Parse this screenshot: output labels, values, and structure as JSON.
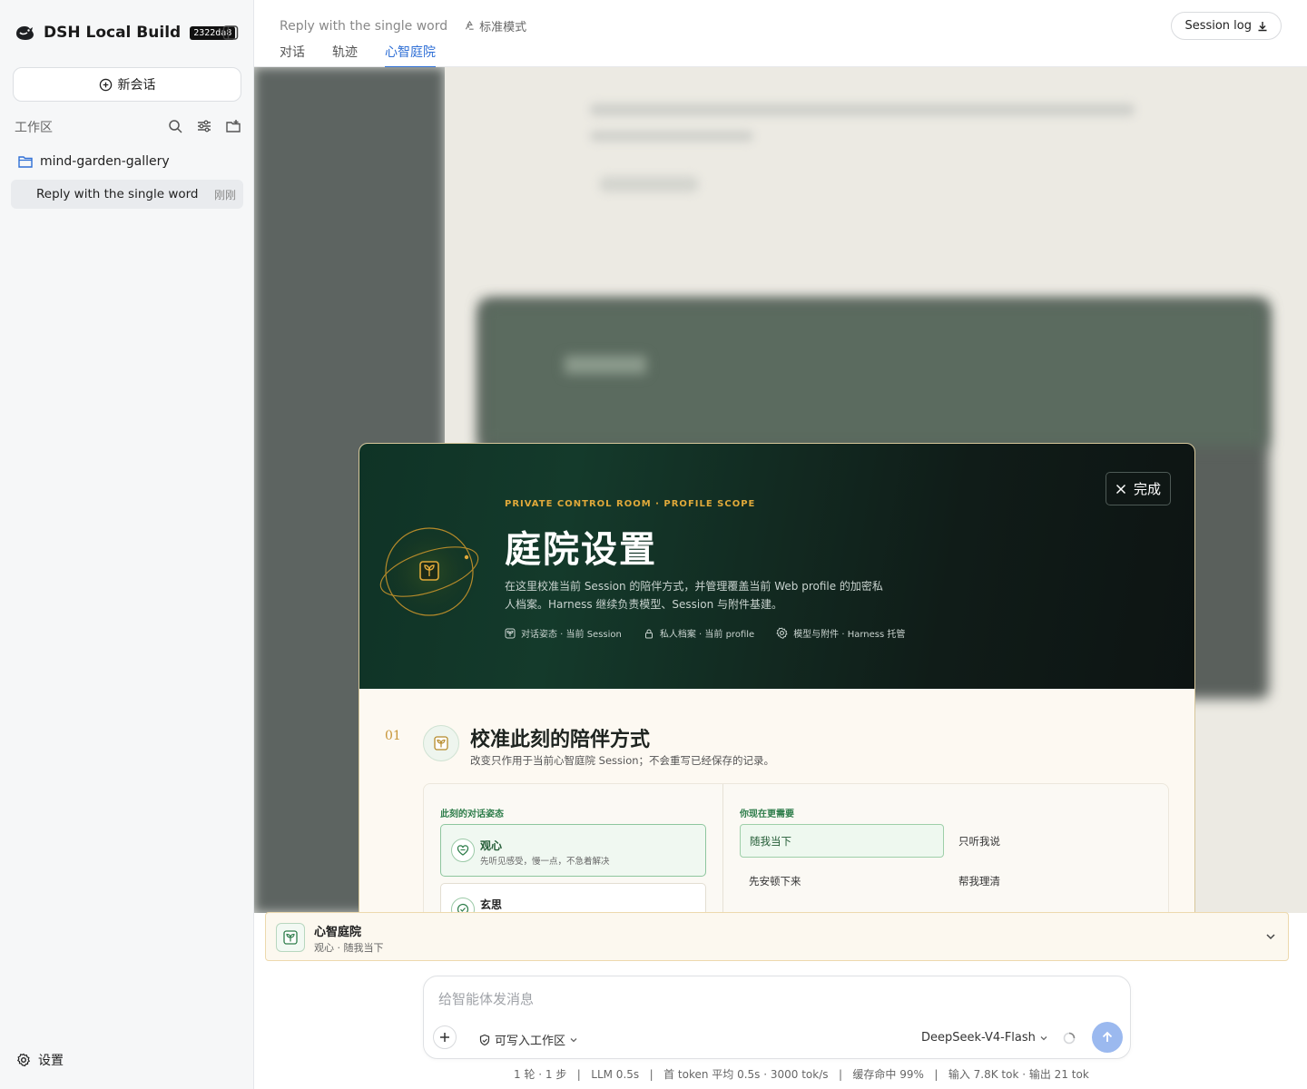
{
  "app": {
    "name": "DSH Local Build",
    "build": "2322da8"
  },
  "sidebar": {
    "new_chat": "新会话",
    "workspace_label": "工作区",
    "folder": "mind-garden-gallery",
    "session_title": "Reply with the single word",
    "session_time": "刚刚",
    "settings": "设置"
  },
  "header": {
    "breadcrumb": "Reply with the single word",
    "mode": "标准模式",
    "tabs": [
      "对话",
      "轨迹",
      "心智庭院"
    ],
    "active_tab": 2,
    "session_log": "Session log"
  },
  "modal": {
    "done": "完成",
    "eyebrow": "PRIVATE CONTROL ROOM · PROFILE SCOPE",
    "title": "庭院设置",
    "description": "在这里校准当前 Session 的陪伴方式，并管理覆盖当前 Web profile 的加密私人档案。Harness 继续负责模型、Session 与附件基建。",
    "meta": [
      "对话姿态 · 当前 Session",
      "私人档案 · 当前 profile",
      "模型与附件 · Harness 托管"
    ],
    "section": {
      "number": "01",
      "title": "校准此刻的陪伴方式",
      "subtitle": "改变只作用于当前心智庭院 Session；不会重写已经保存的记录。",
      "posture_label": "此刻的对话姿态",
      "postures": [
        {
          "title": "观心",
          "desc": "先听见感受，慢一点，不急着解决"
        },
        {
          "title": "玄思",
          "desc": ""
        }
      ],
      "needs_label": "你现在更需要",
      "needs": [
        "随我当下",
        "只听我说",
        "先安顿下来",
        "帮我理清"
      ]
    }
  },
  "garden_bar": {
    "title": "心智庭院",
    "subtitle": "观心 · 随我当下"
  },
  "composer": {
    "placeholder": "给智能体发消息",
    "permission": "可写入工作区",
    "model": "DeepSeek-V4-Flash"
  },
  "stats": "1 轮 · 1 步   |   LLM 0.5s   |   首 token 平均 0.5s · 3000 tok/s   |   缓存命中 99%   |   输入 7.8K tok · 输出 21 tok",
  "colors": {
    "accent_blue": "#2f6fd6",
    "garden_green": "#2e7d4a",
    "gold": "#e0a93a",
    "send_button": "#9bb9ef"
  }
}
